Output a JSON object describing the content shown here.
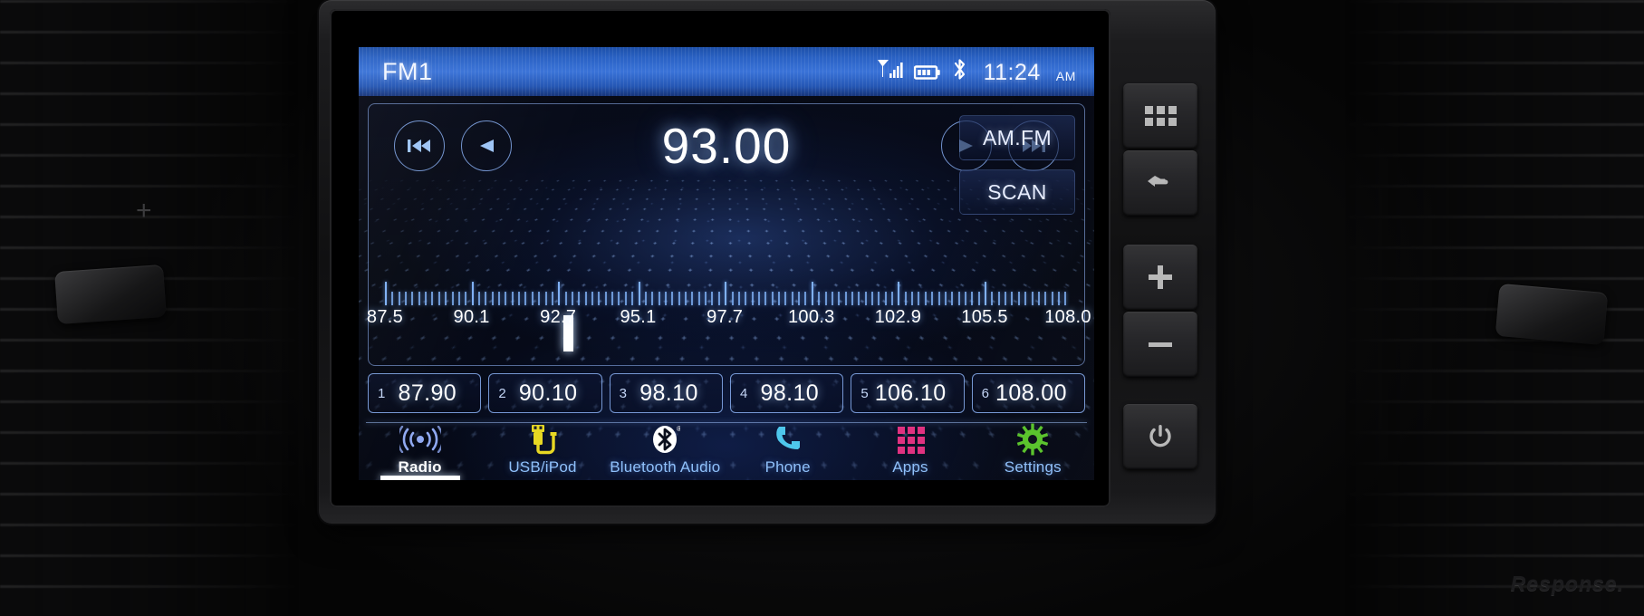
{
  "status_bar": {
    "band": "FM1",
    "icons": [
      "signal-icon",
      "battery-icon",
      "bluetooth-icon"
    ],
    "time": "11:24",
    "ampm": "AM"
  },
  "tuner": {
    "frequency": "93.00",
    "transport": {
      "prev_station": "prev-station-icon",
      "seek_down": "seek-down-icon",
      "seek_up": "seek-up-icon",
      "next_station": "next-station-icon"
    },
    "amfm_label": "AM.FM",
    "scan_label": "SCAN",
    "scale": {
      "min": 87.5,
      "max": 108.0,
      "cursor": 93.0,
      "labels": [
        "87.5",
        "90.1",
        "92.7",
        "95.1",
        "97.7",
        "100.3",
        "102.9",
        "105.5",
        "108.0"
      ],
      "label_values": [
        87.5,
        90.1,
        92.7,
        95.1,
        97.7,
        100.3,
        102.9,
        105.5,
        108.0
      ]
    }
  },
  "presets": [
    {
      "num": "1",
      "freq": "87.90"
    },
    {
      "num": "2",
      "freq": "90.10"
    },
    {
      "num": "3",
      "freq": "98.10"
    },
    {
      "num": "4",
      "freq": "98.10"
    },
    {
      "num": "5",
      "freq": "106.10"
    },
    {
      "num": "6",
      "freq": "108.00"
    }
  ],
  "bottom_nav": [
    {
      "label": "Radio",
      "icon": "radio-waves-icon",
      "color": "#8fa8f0",
      "active": true
    },
    {
      "label": "USB/iPod",
      "icon": "usb-plug-icon",
      "color": "#e8d823",
      "active": false
    },
    {
      "label": "Bluetooth Audio",
      "icon": "bluetooth-icon",
      "color": "#ffffff",
      "active": false
    },
    {
      "label": "Phone",
      "icon": "phone-handset-icon",
      "color": "#4ec7ec",
      "active": false
    },
    {
      "label": "Apps",
      "icon": "apps-grid-icon",
      "color": "#e0317f",
      "active": false
    },
    {
      "label": "Settings",
      "icon": "gear-icon",
      "color": "#58c22a",
      "active": false
    }
  ],
  "hardware_buttons": [
    {
      "name": "menu",
      "icon": "grid-menu-icon"
    },
    {
      "name": "back",
      "icon": "back-arrow-icon"
    },
    {
      "name": "plus",
      "icon": "plus-icon"
    },
    {
      "name": "minus",
      "icon": "minus-icon"
    },
    {
      "name": "power",
      "icon": "power-icon"
    }
  ],
  "watermark": "Response.",
  "colors": {
    "status_bar_blue": "#2a62c4",
    "accent_blue": "#7fb0f5",
    "screen_bg": "#05080f",
    "preset_border": "#91b9ff"
  }
}
